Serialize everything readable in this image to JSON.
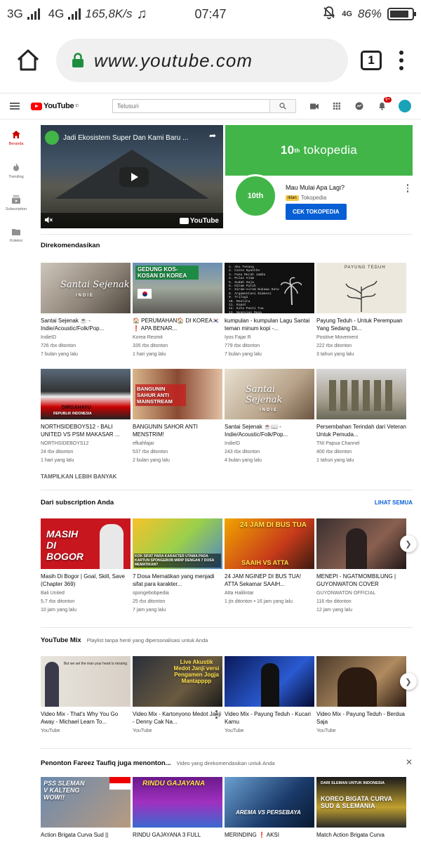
{
  "status": {
    "network_left": "3G",
    "network_right": "4G",
    "speed": "165,8K/s",
    "time": "07:47",
    "network_badge": "4G",
    "battery": "86%",
    "battery_level": 0.86
  },
  "browser": {
    "url": "www.youtube.com",
    "tab_count": "1"
  },
  "youtube": {
    "logo": "YouTube",
    "logo_region": "ID",
    "search_placeholder": "Telusuri",
    "notif_count": "9+"
  },
  "sidebar": {
    "items": [
      {
        "label": "Beranda"
      },
      {
        "label": "Trending"
      },
      {
        "label": "Subscription"
      },
      {
        "label": "Koleksi"
      }
    ]
  },
  "banner": {
    "video_title": "Jadi Ekosistem Super Dan Kami Baru ...",
    "ad_brand_big": "10",
    "ad_brand_sup": "th",
    "ad_brand_name": "tokopedia",
    "ad_logo": "10th",
    "ad_title": "Mau Mulai Apa Lagi?",
    "ad_badge": "Iklan",
    "ad_channel": "Tokopedia",
    "ad_cta": "CEK TOKOPEDIA",
    "yt_mark": "YouTube"
  },
  "recommended": {
    "title": "Direkomendasikan",
    "show_more": "TAMPILKAN LEBIH BANYAK",
    "row1": [
      {
        "title": "Santai Sejenak ☕ - Indie/Acoustic/Folk/Pop...",
        "channel": "IndieID",
        "views": "726 rbx ditonton",
        "age": "7 bulan yang lalu",
        "thumb_text": "Santai Sejenak",
        "thumb_sub": "INDIE"
      },
      {
        "title": "🏠 PERUMAHAN🏠 DI KOREA🇰🇷❗ APA BENAR...",
        "channel": "Korea Reomit",
        "views": "335 rbx ditonton",
        "age": "1 hari yang lalu",
        "thumb_text": "GEDUNG KOS-KOSAN DI KOREA"
      },
      {
        "title": "kumpulan - kumpulan Lagu Santai teman minum kopi -...",
        "channel": "Iyos Fajar R",
        "views": "779 rbx ditonton",
        "age": "7 bulan yang lalu",
        "thumb_text": "1. Aku Tenang\n2. Cinta Nyanthe\n3. Fana Merah Jambu\n4. Pulas Alam\n5. Sudah Saja\n6. Hitam Putih\n7. Siram-siram Kukuwa Satu\n8. Argumentasi Dimensi\n9. Trilogi\n10. Realita\n11. Kopet\n12. Kita Pasti Tua\n13. Nyanyian Rasa\n14. Kita Bukan Bintang\n15. Desember\n16. Irikan Ringan"
      },
      {
        "title": "Payung Teduh - Untuk Perempuan Yang Sedang Di...",
        "channel": "Positive Movement",
        "views": "222 rbx ditonton",
        "age": "3 tahun yang lalu",
        "thumb_text": "PAYUNG TEDUH"
      }
    ],
    "row2": [
      {
        "title": "NORTHSIDEBOYS12 - BALI UNITED VS PSM MAKASAR ...",
        "channel": "NORTHSIDEBOYS12",
        "views": "24 rbx ditonton",
        "age": "1 hari yang lalu",
        "thumb_text": "DIRGAHAYU",
        "thumb_sub": "REPUBLIK INDONESIA"
      },
      {
        "title": "BANGUNIN SAHOR ANTI MENSTRIM!",
        "channel": "efkahfajar",
        "views": "537 rbx ditonton",
        "age": "2 bulan yang lalu",
        "thumb_text": "BANGUNIN SAHUR ANTI MAINSTREAM"
      },
      {
        "title": "Santai Sejenak ☕📖 - Indie/Acoustic/Folk/Pop...",
        "channel": "IndieID",
        "views": "243 rbx ditonton",
        "age": "4 bulan yang lalu",
        "thumb_text": "Santai Sejenak",
        "thumb_sub": "INDIE"
      },
      {
        "title": "Persembahan Terindah dari Veteran Untuk Pemuda...",
        "channel": "TNI Papua Channel",
        "views": "400 rbx ditonton",
        "age": "1 tahun yang lalu"
      }
    ]
  },
  "subscription": {
    "title": "Dari subscription Anda",
    "link": "LIHAT SEMUA",
    "items": [
      {
        "title": "Masih Di Bogor | Goal, Skill, Save (Chapter 369)",
        "channel": "Bali United",
        "views": "5,7 rbx ditonton",
        "age": "10 jam yang lalu",
        "thumb_text": "MASIH DI BOGOR"
      },
      {
        "title": "7 Dosa Mematikan yang menjadi sifat para karakter...",
        "channel": "spongebobpedia",
        "views": "25 rbx ditonton",
        "age": "7 jam yang lalu",
        "thumb_text": "KOK SIFAT PARA KARAKTER UTAMA PADA KARTUN SPONGEBOB MIRIP DENGAN 7 DOSA MEMATIKAN?"
      },
      {
        "title": "24 JAM NGINEP DI BUS TUA! ATTA Sekamar SAAIH...",
        "channel": "Atta Halilintar",
        "views": "1 jtx ditonton",
        "age": "16 jam yang lalu",
        "thumb_text": "24 JAM DI BUS TUA",
        "thumb_sub": "SAAIH VS ATTA"
      },
      {
        "title": "MENEPI - NGATMOMBILUNG | GUYONWATON COVER",
        "channel": "GUYONWATON OFFICIAL",
        "views": "116 rbx ditonton",
        "age": "12 jam yang lalu"
      }
    ]
  },
  "mix": {
    "title": "YouTube Mix",
    "subtitle": "Playlist tanpa henti yang dipersonalisasi untuk Anda",
    "items": [
      {
        "title": "Video Mix - That's Why You Go Away - Michael Learn To...",
        "channel": "YouTube",
        "thumb_text": "But we set the man your heart is missing"
      },
      {
        "title": "Video Mix - Kartonyono Medot Janji - Denny Cak Na...",
        "channel": "YouTube",
        "thumb_text": "Live Akustik Medot Janji versi Pengamen Jogja Mantapppp"
      },
      {
        "title": "Video Mix - Payung Teduh - Kucari Kamu",
        "channel": "YouTube"
      },
      {
        "title": "Video Mix - Payung Teduh - Berdua Saja",
        "channel": "YouTube"
      }
    ]
  },
  "alsowatching": {
    "title": "Penonton Fareez Taufiq juga menonton...",
    "subtitle": "Video yang direkomendasikan untuk Anda",
    "items": [
      {
        "title": "Action Brigata Curva Sud ||",
        "thumb_text": "PSS SLEMAN V KALTENG WOW!!"
      },
      {
        "title": "RINDU GAJAYANA 3 FULL",
        "thumb_text": "RINDU GAJAYANA"
      },
      {
        "title": "MERINDING ❗ AKSI",
        "thumb_text": "AREMA VS PERSEBAYA"
      },
      {
        "title": "Match Action Brigata Curva",
        "thumb_text": "DARI SLEMAN UNTUK INDONESIA",
        "thumb_sub": "KOREO BIGATA CURVA SUD & SLEMANIA"
      }
    ]
  }
}
